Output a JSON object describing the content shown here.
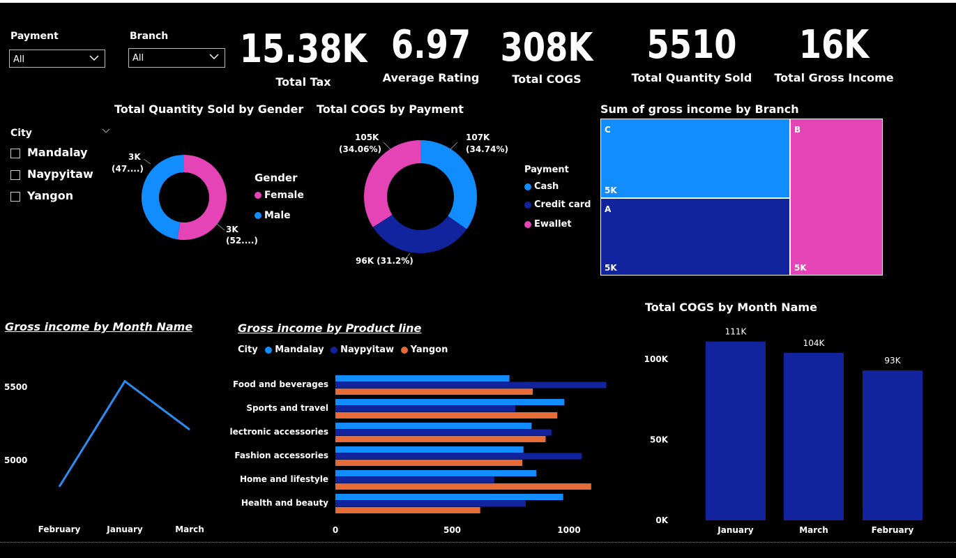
{
  "filters": {
    "payment": {
      "label": "Payment",
      "value": "All"
    },
    "branch": {
      "label": "Branch",
      "value": "All"
    }
  },
  "kpis": [
    {
      "value": "15.38K",
      "label": "Total Tax"
    },
    {
      "value": "6.97",
      "label": "Average Rating"
    },
    {
      "value": "308K",
      "label": "Total COGS"
    },
    {
      "value": "5510",
      "label": "Total Quantity Sold"
    },
    {
      "value": "16K",
      "label": "Total Gross Income"
    }
  ],
  "city_slicer": {
    "label": "City",
    "items": [
      "Mandalay",
      "Naypyitaw",
      "Yangon"
    ]
  },
  "colors": {
    "pink": "#e444b5",
    "blue": "#118dff",
    "navy": "#12239e",
    "orange": "#e66c37",
    "line": "#2b8df0"
  },
  "chart_data": [
    {
      "type": "pie",
      "title": "Total Quantity Sold by Gender",
      "legend_title": "Gender",
      "categories": [
        "Female",
        "Male"
      ],
      "values": [
        0.52,
        0.47
      ],
      "data_labels": [
        {
          "value": "3K",
          "pct": "(52....)"
        },
        {
          "value": "3K",
          "pct": "(47....)"
        }
      ]
    },
    {
      "type": "pie",
      "title": "Total COGS by Payment",
      "legend_title": "Payment",
      "categories": [
        "Cash",
        "Credit card",
        "Ewallet"
      ],
      "values": [
        34.74,
        31.2,
        34.06
      ],
      "data_labels": [
        {
          "value": "107K",
          "pct": "(34.74%)"
        },
        {
          "value": "96K (31.2%)",
          "pct": ""
        },
        {
          "value": "105K",
          "pct": "(34.06%)"
        }
      ]
    },
    {
      "type": "treemap",
      "title": "Sum of gross income by Branch",
      "categories": [
        "C",
        "A",
        "B"
      ],
      "values": [
        5.3,
        5.1,
        5.2
      ],
      "value_labels": [
        "5K",
        "5K",
        "5K"
      ]
    },
    {
      "type": "line",
      "title": "Gross income by Month Name",
      "categories": [
        "February",
        "January",
        "March"
      ],
      "values": [
        4820,
        5540,
        5210
      ],
      "y_ticks": [
        "5000",
        "5500"
      ]
    },
    {
      "type": "bar",
      "orientation": "horizontal",
      "title": "Gross income by Product line",
      "legend_title": "City",
      "categories": [
        "Food and beverages",
        "Sports and travel",
        "Electronic accessories",
        "Fashion accessories",
        "Home and lifestyle",
        "Health and beauty"
      ],
      "series": [
        {
          "name": "Mandalay",
          "values": [
            745,
            980,
            840,
            805,
            860,
            975
          ]
        },
        {
          "name": "Naypyitaw",
          "values": [
            1160,
            770,
            925,
            1055,
            680,
            815
          ]
        },
        {
          "name": "Yangon",
          "values": [
            845,
            950,
            900,
            800,
            1095,
            620
          ]
        }
      ],
      "xlim": [
        0,
        1200
      ],
      "x_ticks": [
        0,
        500,
        1000
      ]
    },
    {
      "type": "bar",
      "title": "Total COGS by Month Name",
      "categories": [
        "January",
        "March",
        "February"
      ],
      "values": [
        111,
        104,
        93
      ],
      "value_labels": [
        "111K",
        "104K",
        "93K"
      ],
      "ylim": [
        0,
        120
      ],
      "y_ticks": [
        "0K",
        "50K",
        "100K"
      ]
    }
  ]
}
